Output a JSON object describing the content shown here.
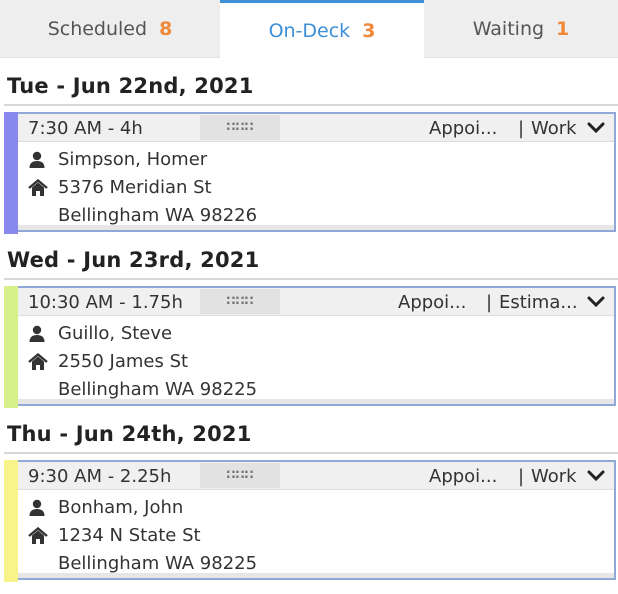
{
  "tabs": [
    {
      "label": "Scheduled",
      "count": "8"
    },
    {
      "label": "On-Deck",
      "count": "3"
    },
    {
      "label": "Waiting",
      "count": "1"
    }
  ],
  "days": [
    {
      "header": "Tue - Jun 22nd, 2021",
      "card": {
        "time": "7:30 AM - 4h",
        "appointment": "Appoi...",
        "separator": "|",
        "type": "Work",
        "name": "Simpson, Homer",
        "street": "5376 Meridian St",
        "city": "Bellingham WA 98226",
        "stripe_color": "#8888ee"
      }
    },
    {
      "header": "Wed - Jun 23rd, 2021",
      "card": {
        "time": "10:30 AM - 1.75h",
        "appointment": "Appoi...",
        "separator": "|",
        "type": "Estima...",
        "name": "Guillo, Steve",
        "street": "2550 James St",
        "city": "Bellingham WA 98225",
        "stripe_color": "#d6f08a"
      }
    },
    {
      "header": "Thu - Jun 24th, 2021",
      "card": {
        "time": "9:30 AM - 2.25h",
        "appointment": "Appoi...",
        "separator": "|",
        "type": "Work",
        "name": "Bonham, John",
        "street": "1234 N State St",
        "city": "Bellingham WA 98225",
        "stripe_color": "#f8f48a"
      }
    }
  ],
  "colors": {
    "accent": "#3d8fd6",
    "count": "#f0883a",
    "card_border": "#8fa8d6"
  }
}
